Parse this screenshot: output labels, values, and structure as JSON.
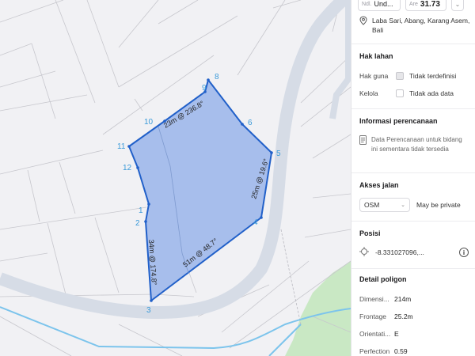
{
  "header": {
    "unit_label": "Ndl.",
    "unit_value": "Und...",
    "area_label": "Are",
    "area_value": "31.73",
    "dropdown_glyph": "⌄"
  },
  "location": {
    "icon": "map-pin-icon",
    "text": "Laba Sari, Abang, Karang Asem, Bali"
  },
  "hak_lahan": {
    "title": "Hak lahan",
    "rows": [
      {
        "label": "Hak guna",
        "value": "Tidak terdefinisi",
        "checked": true
      },
      {
        "label": "Kelola",
        "value": "Tidak ada data",
        "checked": false
      }
    ]
  },
  "perencanaan": {
    "title": "Informasi perencanaan",
    "icon": "document-icon",
    "text": "Data Perencanaan untuk bidang ini sementara tidak tersedia"
  },
  "akses": {
    "title": "Akses jalan",
    "select_value": "OSM",
    "note": "May be private"
  },
  "posisi": {
    "title": "Posisi",
    "value": "-8.331027096,...",
    "icon": "crosshair-icon",
    "info_icon": "info-icon"
  },
  "detail": {
    "title": "Detail poligon",
    "items": [
      {
        "key": "Dimensi...",
        "value": "214m"
      },
      {
        "key": "Frontage",
        "value": "25.2m"
      },
      {
        "key": "Orientati...",
        "value": "E"
      },
      {
        "key": "Perfection",
        "value": "0.59"
      }
    ]
  },
  "map": {
    "vertex_labels": [
      "1",
      "2",
      "3",
      "4",
      "5",
      "6",
      "8",
      "9",
      "10",
      "11",
      "12"
    ],
    "edge_labels": [
      "23m @ 236.8°",
      "25m @ 19.6°",
      "51m @ 48.7°",
      "34m @ 174.8°"
    ],
    "colors": {
      "polygon_fill": "#9fb8eb",
      "polygon_stroke": "#2160c9",
      "vertex_label": "#3a9ad9",
      "road": "#d6dce6",
      "river": "#7cc4ec",
      "park": "#c9e8c4"
    }
  }
}
